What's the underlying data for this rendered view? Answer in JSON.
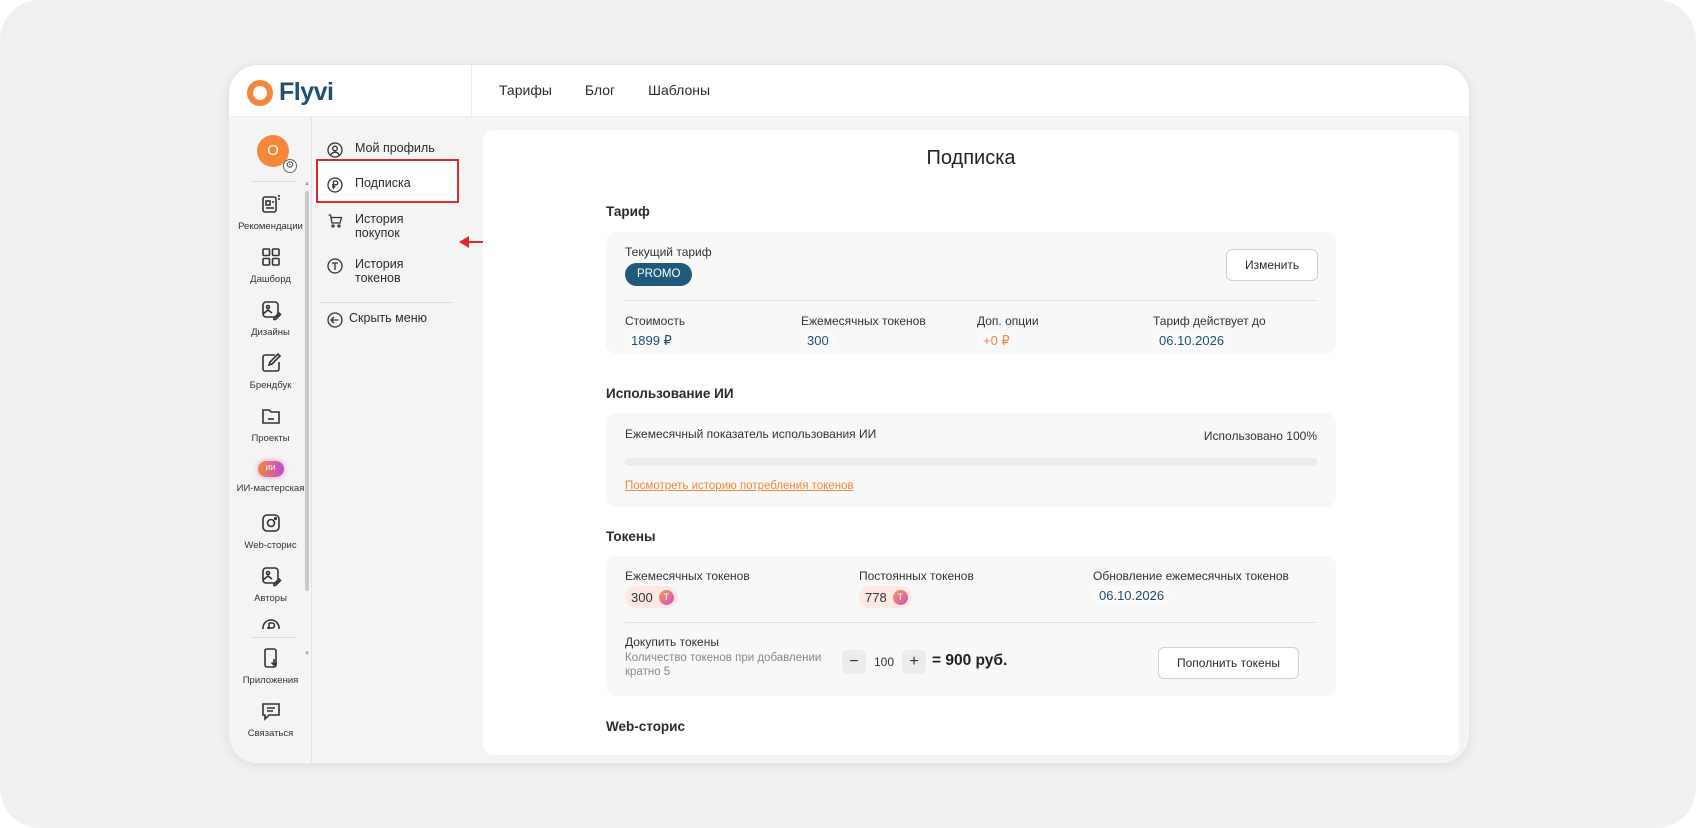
{
  "app": {
    "logo_text": "Flyvi"
  },
  "topnav": [
    "Тарифы",
    "Блог",
    "Шаблоны"
  ],
  "user": {
    "initial": "О"
  },
  "rail": {
    "items": [
      {
        "label": "Рекомендации",
        "icon": "recommendations-icon"
      },
      {
        "label": "Дашборд",
        "icon": "dashboard-grid-icon"
      },
      {
        "label": "Дизайны",
        "icon": "designs-image-icon"
      },
      {
        "label": "Брендбук",
        "icon": "brandbook-edit-icon"
      },
      {
        "label": "Проекты",
        "icon": "folder-icon"
      },
      {
        "label": "ИИ-мастерская",
        "icon": "ai-workshop-icon",
        "badge": "ИИ"
      },
      {
        "label": "Web-сторис",
        "icon": "instagram-icon"
      },
      {
        "label": "Авторы",
        "icon": "authors-image-icon"
      }
    ],
    "bottom": [
      {
        "label": "Приложения",
        "icon": "mobile-download-icon"
      },
      {
        "label": "Связаться",
        "icon": "chat-icon"
      }
    ]
  },
  "submenu": {
    "profile": "Мой профиль",
    "subscription": "Подписка",
    "purchases_1": "История",
    "purchases_2": "покупок",
    "tokens_1": "История",
    "tokens_2": "токенов",
    "hide": "Скрыть меню"
  },
  "page": {
    "title": "Подписка",
    "tariff": {
      "section": "Тариф",
      "current_label": "Текущий тариф",
      "current_value": "PROMO",
      "change_button": "Изменить",
      "cost_label": "Стоимость",
      "cost_value": "1899 ₽",
      "monthly_label": "Ежемесячных токенов",
      "monthly_value": "300",
      "options_label": "Доп. опции",
      "options_value": "+0 ₽",
      "valid_label": "Тариф действует до",
      "valid_value": "06.10.2026"
    },
    "ai_usage": {
      "section": "Использование ИИ",
      "indicator_label": "Ежемесячный показатель использования ИИ",
      "used_text": "Использовано 100%",
      "used_fraction": 1.0,
      "history_link": "Посмотреть историю потребления токенов"
    },
    "tokens": {
      "section": "Токены",
      "monthly_label": "Ежемесячных токенов",
      "monthly_value": "300",
      "permanent_label": "Постоянных токенов",
      "permanent_value": "778",
      "renewal_label": "Обновление ежемесячных токенов",
      "renewal_value": "06.10.2026",
      "buy_label": "Докупить токены",
      "buy_hint_1": "Количество токенов при добавлении",
      "buy_hint_2": "кратно 5",
      "qty": "100",
      "total": "= 900 руб.",
      "topup_button": "Пополнить токены",
      "minus": "−",
      "plus": "+",
      "coin": "T"
    },
    "webstories": {
      "section": "Web-сторис"
    }
  },
  "colors": {
    "accent": "#f5873a",
    "brand": "#1f4f73",
    "annotation": "#e1262c"
  }
}
